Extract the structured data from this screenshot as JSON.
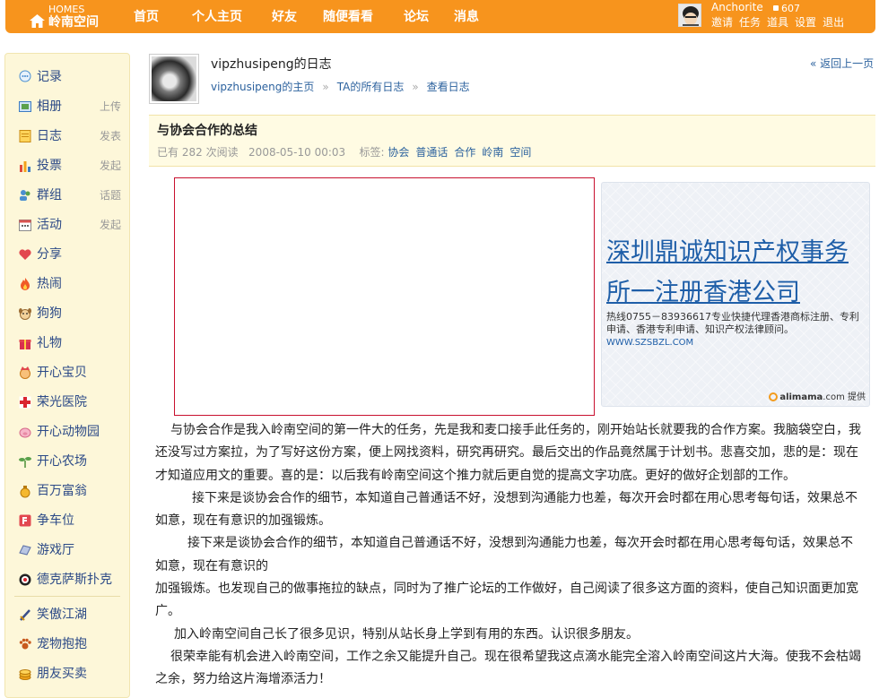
{
  "brand": {
    "en": "HOMES",
    "cn": "岭南空间"
  },
  "nav": [
    "首页",
    "个人主页",
    "好友",
    "随便看看",
    "论坛",
    "消息"
  ],
  "user": {
    "name": "Anchorite",
    "coins": "607",
    "links": [
      "邀请",
      "任务",
      "道具",
      "设置",
      "退出"
    ]
  },
  "sidebar": [
    {
      "label": "记录",
      "action": "",
      "icon": "speech-bubble-icon"
    },
    {
      "label": "相册",
      "action": "上传",
      "icon": "photo-icon"
    },
    {
      "label": "日志",
      "action": "发表",
      "icon": "notebook-icon"
    },
    {
      "label": "投票",
      "action": "发起",
      "icon": "bar-chart-icon"
    },
    {
      "label": "群组",
      "action": "话题",
      "icon": "group-icon"
    },
    {
      "label": "活动",
      "action": "发起",
      "icon": "calendar-icon"
    },
    {
      "label": "分享",
      "action": "",
      "icon": "heart-icon"
    },
    {
      "label": "热闹",
      "action": "",
      "icon": "fire-icon"
    },
    {
      "label": "狗狗",
      "action": "",
      "icon": "dog-icon"
    },
    {
      "label": "礼物",
      "action": "",
      "icon": "gift-icon"
    },
    {
      "label": "开心宝贝",
      "action": "",
      "icon": "baby-icon"
    },
    {
      "label": "荣光医院",
      "action": "",
      "icon": "hospital-cross-icon"
    },
    {
      "label": "开心动物园",
      "action": "",
      "icon": "pig-icon"
    },
    {
      "label": "开心农场",
      "action": "",
      "icon": "sprout-icon"
    },
    {
      "label": "百万富翁",
      "action": "",
      "icon": "money-bag-icon"
    },
    {
      "label": "争车位",
      "action": "",
      "icon": "parking-icon"
    },
    {
      "label": "游戏厅",
      "action": "",
      "icon": "gamepad-icon"
    },
    {
      "label": "德克萨斯扑克",
      "action": "",
      "icon": "poker-chip-icon"
    },
    {
      "label": "笑傲江湖",
      "action": "",
      "icon": "sword-icon"
    },
    {
      "label": "宠物抱抱",
      "action": "",
      "icon": "paw-icon"
    },
    {
      "label": "朋友买卖",
      "action": "",
      "icon": "coins-icon"
    }
  ],
  "blog": {
    "owner_title": "vipzhusipeng的日志",
    "crumbs": [
      "vipzhusipeng的主页",
      "TA的所有日志",
      "查看日志"
    ],
    "back": "« 返回上一页"
  },
  "entry": {
    "title": "与协会合作的总结",
    "meta_prefix": "已有",
    "views": "282",
    "meta_views_suffix": "次阅读",
    "date": "2008-05-10 00:03",
    "tags_label": "标签:",
    "tags": [
      "协会",
      "普通话",
      "合作",
      "岭南",
      "空间"
    ]
  },
  "ad": {
    "headline": "深圳鼎诚知识产权事务所一注册香港公司",
    "desc": "热线0755－83936617专业快捷代理香港商标注册、专利申请、香港专利申请、知识产权法律顾问。",
    "url": "WWW.SZSBZL.COM",
    "brand": "alimama",
    "brand_suffix": ".com 提供"
  },
  "article": [
    "与协会合作是我入岭南空间的第一件大的任务，先是我和麦口接手此任务的，刚开始站长就要我的合作方案。我脑袋空白，我还没写过方案拉，为了写好这份方案，便上网找资料，研究再研究。最后交出的作品竟然属于计划书。悲喜交加，悲的是：现在才知道应用文的重要。喜的是：以后我有岭南空间这个推力就后更自觉的提高文字功底。更好的做好企划部的工作。",
    "接下来是谈协会合作的细节，本知道自己普通话不好，没想到沟通能力也差，每次开会时都在用心思考每句话，效果总不如意，现在有意识的加强锻炼。",
    "接下来是谈协会合作的细节，本知道自己普通话不好，没想到沟通能力也差，每次开会时都在用心思考每句话，效果总不如意，现在有意识的",
    "加强锻炼。也发现自己的做事拖拉的缺点，同时为了推广论坛的工作做好，自己阅读了很多这方面的资料，使自己知识面更加宽广。",
    "加入岭南空间自己长了很多见识，特别从站长身上学到有用的东西。认识很多朋友。",
    "很荣幸能有机会进入岭南空间，工作之余又能提升自己。现在很希望我这点滴水能完全溶入岭南空间这片大海。使我不会枯竭之余，努力给这片海增添活力！"
  ]
}
